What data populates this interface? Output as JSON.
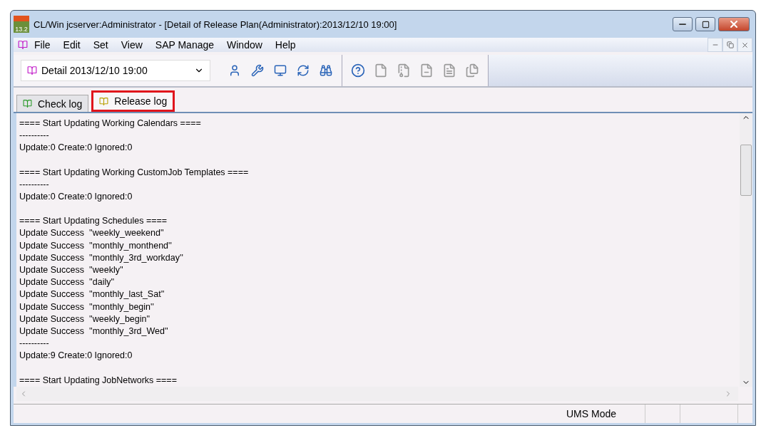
{
  "window": {
    "title": "CL/Win jcserver:Administrator - [Detail of Release Plan(Administrator):2013/12/10 19:00]",
    "app_badge": "13.2"
  },
  "menu": [
    "File",
    "Edit",
    "Set",
    "View",
    "SAP Manage",
    "Window",
    "Help"
  ],
  "toolbar": {
    "plan_select": {
      "value": "Detail 2013/12/10 19:00"
    },
    "buttons": [
      {
        "disabled": false
      },
      {
        "disabled": false
      },
      {
        "disabled": false
      },
      {
        "disabled": false
      },
      {
        "disabled": false
      },
      {
        "disabled": false
      },
      {
        "disabled": true
      },
      {
        "disabled": true
      },
      {
        "disabled": true
      },
      {
        "disabled": true
      },
      {
        "disabled": true
      }
    ]
  },
  "tabs": [
    {
      "label": "Check log",
      "selected": false,
      "highlighted": false
    },
    {
      "label": "Release log",
      "selected": true,
      "highlighted": true
    }
  ],
  "log": [
    [
      "==== Start Updating Working Calendars ====",
      "----------",
      "Update:0 Create:0 Ignored:0"
    ],
    [
      "==== Start Updating Working CustomJob Templates ====",
      "----------",
      "Update:0 Create:0 Ignored:0"
    ],
    [
      "==== Start Updating Schedules ====",
      "Update Success  ''weekly_weekend''",
      "Update Success  ''monthly_monthend''",
      "Update Success  ''monthly_3rd_workday''",
      "Update Success  ''weekly''",
      "Update Success  ''daily''",
      "Update Success  ''monthly_last_Sat''",
      "Update Success  ''monthly_begin''",
      "Update Success  ''weekly_begin''",
      "Update Success  ''monthly_3rd_Wed''",
      "----------",
      "Update:9 Create:0 Ignored:0"
    ],
    [
      "==== Start Updating JobNetworks ===="
    ]
  ],
  "status_bar": {
    "mode": "UMS Mode"
  }
}
